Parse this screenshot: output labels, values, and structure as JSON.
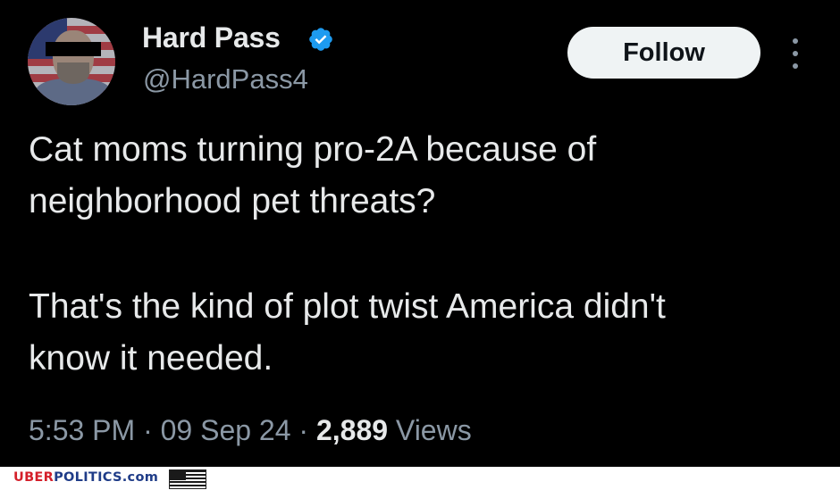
{
  "tweet": {
    "author": {
      "name": "Hard Pass",
      "handle": "@HardPass4",
      "verified": true,
      "verified_icon": "verified-badge-icon",
      "verified_color": "#1d9bf0"
    },
    "follow_label": "Follow",
    "more_icon": "more-options-icon",
    "body": {
      "paragraph_1_line_1": "Cat moms turning pro-2A because of",
      "paragraph_1_line_2": "neighborhood pet threats?",
      "paragraph_2_line_1": "That's the kind of plot twist America didn't",
      "paragraph_2_line_2": "know it needed."
    },
    "meta": {
      "time": "5:53 PM",
      "separator": "·",
      "date": "09 Sep 24",
      "views_count": "2,889",
      "views_label": "Views"
    }
  },
  "footer": {
    "brand_part_1": "UBER",
    "brand_part_2": "POLITICS.com",
    "brand_color_1": "#d41f2a",
    "brand_color_2": "#1f3c88",
    "flag_icon": "us-flag-icon"
  },
  "colors": {
    "background": "#000000",
    "primary_text": "#e7e9ea",
    "secondary_text": "#8b98a5",
    "button_bg": "#eff3f4"
  }
}
